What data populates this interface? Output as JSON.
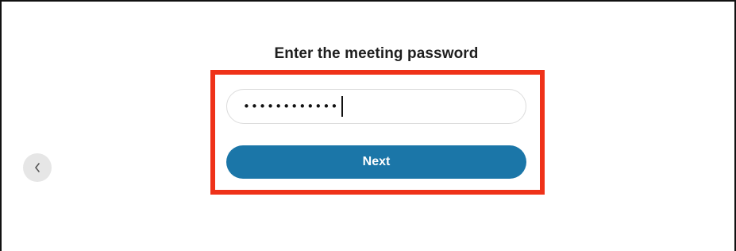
{
  "prompt": {
    "title": "Enter the meeting password"
  },
  "password_field": {
    "value": "••••••••••••"
  },
  "next_button": {
    "label": "Next"
  },
  "back_button": {
    "icon": "chevron-left-icon"
  },
  "colors": {
    "highlight": "#ef3219",
    "button": "#1b76a8"
  }
}
